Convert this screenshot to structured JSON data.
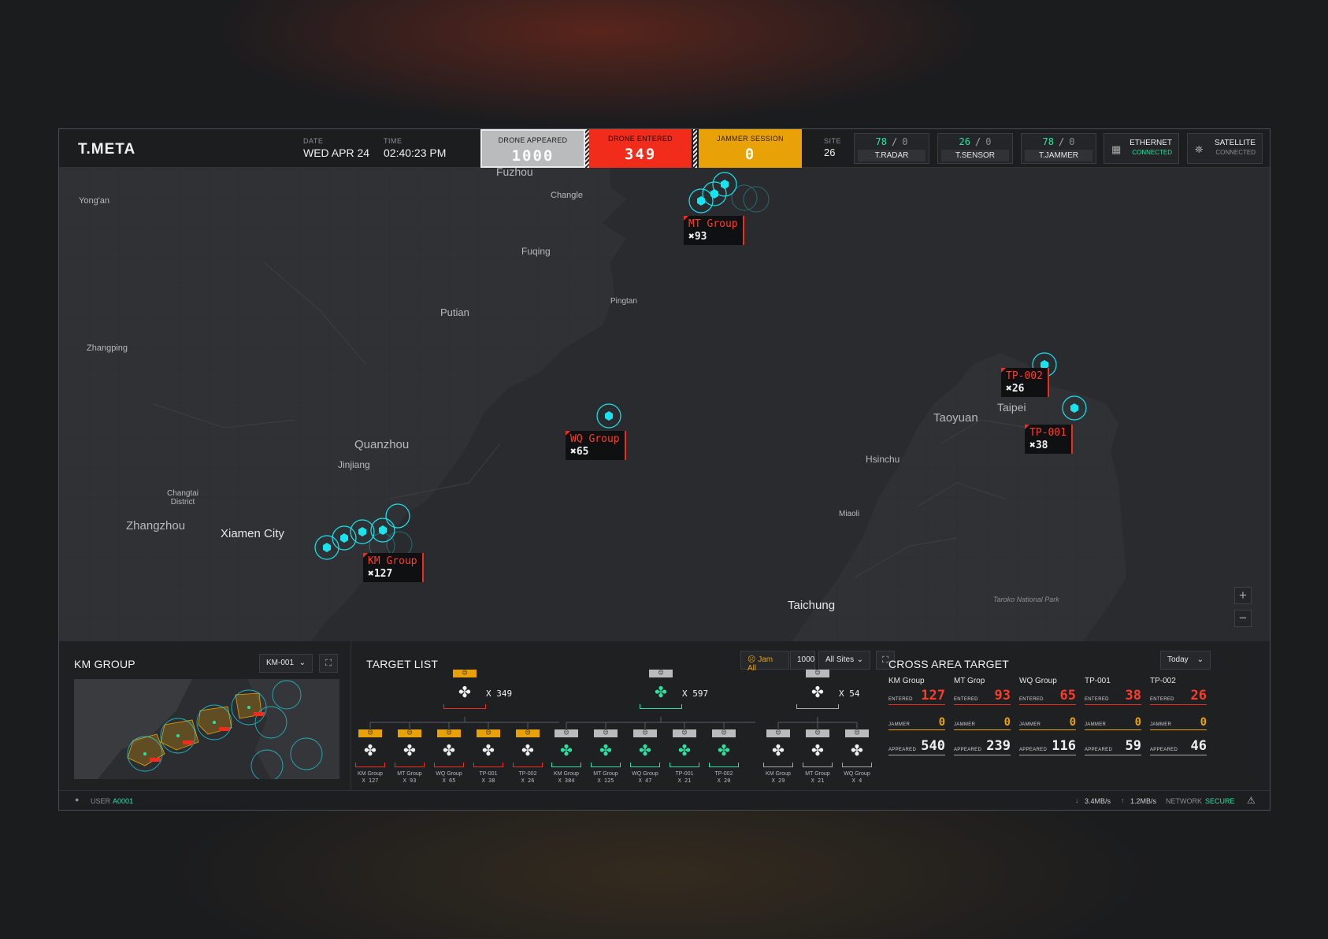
{
  "header": {
    "brand": "T.META",
    "date_label": "DATE",
    "date": "WED APR 24",
    "time_label": "TIME",
    "time": "02:40:23 PM",
    "stats": [
      {
        "label": "DRONE APPEARED",
        "value": "1000"
      },
      {
        "label": "DRONE ENTERED",
        "value": "349"
      },
      {
        "label": "JAMMER SESSION",
        "value": "0"
      }
    ],
    "site_label": "SITE",
    "site": "26",
    "devices": [
      {
        "name": "T.RADAR",
        "online": "78",
        "offline": "0"
      },
      {
        "name": "T.SENSOR",
        "online": "26",
        "offline": "0"
      },
      {
        "name": "T.JAMMER",
        "online": "78",
        "offline": "0"
      }
    ],
    "network": [
      {
        "name": "ETHERNET",
        "status": "CONNECTED",
        "icon": "ethernet-icon"
      },
      {
        "name": "SATELLITE",
        "status": "CONNECTED",
        "icon": "satellite-icon"
      }
    ]
  },
  "map": {
    "places": [
      "Fuzhou",
      "Changle",
      "Yong'an",
      "Fuqing",
      "Putian",
      "Pingtan",
      "Zhangping",
      "Quanzhou",
      "Jinjiang",
      "Changtai District",
      "Zhangzhou",
      "Xiamen City",
      "Taoyuan",
      "Taipei",
      "Hsinchu",
      "Miaoli",
      "Taichung",
      "Taroko National Park"
    ],
    "groups": [
      {
        "name": "MT Group",
        "count": "93"
      },
      {
        "name": "WQ Group",
        "count": "65"
      },
      {
        "name": "KM Group",
        "count": "127"
      },
      {
        "name": "TP-002",
        "count": "26"
      },
      {
        "name": "TP-001",
        "count": "38"
      }
    ],
    "zoom_in": "+",
    "zoom_out": "−"
  },
  "km_panel": {
    "title": "KM GROUP",
    "select": "KM-001"
  },
  "target_list": {
    "title": "TARGET LIST",
    "jam_all": "Jam All",
    "jam_count": "1000",
    "sites": "All Sites",
    "roots": [
      {
        "count": "X 349"
      },
      {
        "count": "X 597"
      },
      {
        "count": "X 54"
      }
    ],
    "children": [
      {
        "name": "KM Group",
        "count": "X 127"
      },
      {
        "name": "MT Group",
        "count": "X 93"
      },
      {
        "name": "WQ Group",
        "count": "X 65"
      },
      {
        "name": "TP-001",
        "count": "X 38"
      },
      {
        "name": "TP-002",
        "count": "X 26"
      },
      {
        "name": "KM Group",
        "count": "X 384"
      },
      {
        "name": "MT Group",
        "count": "X 125"
      },
      {
        "name": "WQ Group",
        "count": "X 47"
      },
      {
        "name": "TP-001",
        "count": "X 21"
      },
      {
        "name": "TP-002",
        "count": "X 20"
      },
      {
        "name": "KM Group",
        "count": "X 29"
      },
      {
        "name": "MT Group",
        "count": "X 21"
      },
      {
        "name": "WQ Group",
        "count": "X 4"
      }
    ]
  },
  "cross_area": {
    "title": "CROSS AREA TARGET",
    "period": "Today",
    "entered_label": "ENTERED",
    "jammer_label": "JAMMER",
    "appeared_label": "APPEARED",
    "columns": [
      {
        "name": "KM Group",
        "entered": "127",
        "jammer": "0",
        "appeared": "540"
      },
      {
        "name": "MT Grop",
        "entered": "93",
        "jammer": "0",
        "appeared": "239"
      },
      {
        "name": "WQ Group",
        "entered": "65",
        "jammer": "0",
        "appeared": "116"
      },
      {
        "name": "TP-001",
        "entered": "38",
        "jammer": "0",
        "appeared": "59"
      },
      {
        "name": "TP-002",
        "entered": "26",
        "jammer": "0",
        "appeared": "46"
      }
    ]
  },
  "status": {
    "user_label": "USER",
    "user": "A0001",
    "down": "3.4MB/s",
    "up": "1.2MB/s",
    "network_label": "NETWORK",
    "network": "SECURE"
  },
  "colors": {
    "accent_red": "#f22c1b",
    "accent_yellow": "#e8a208",
    "accent_green": "#2ee0a0",
    "drone_cyan": "#18e4f0"
  }
}
